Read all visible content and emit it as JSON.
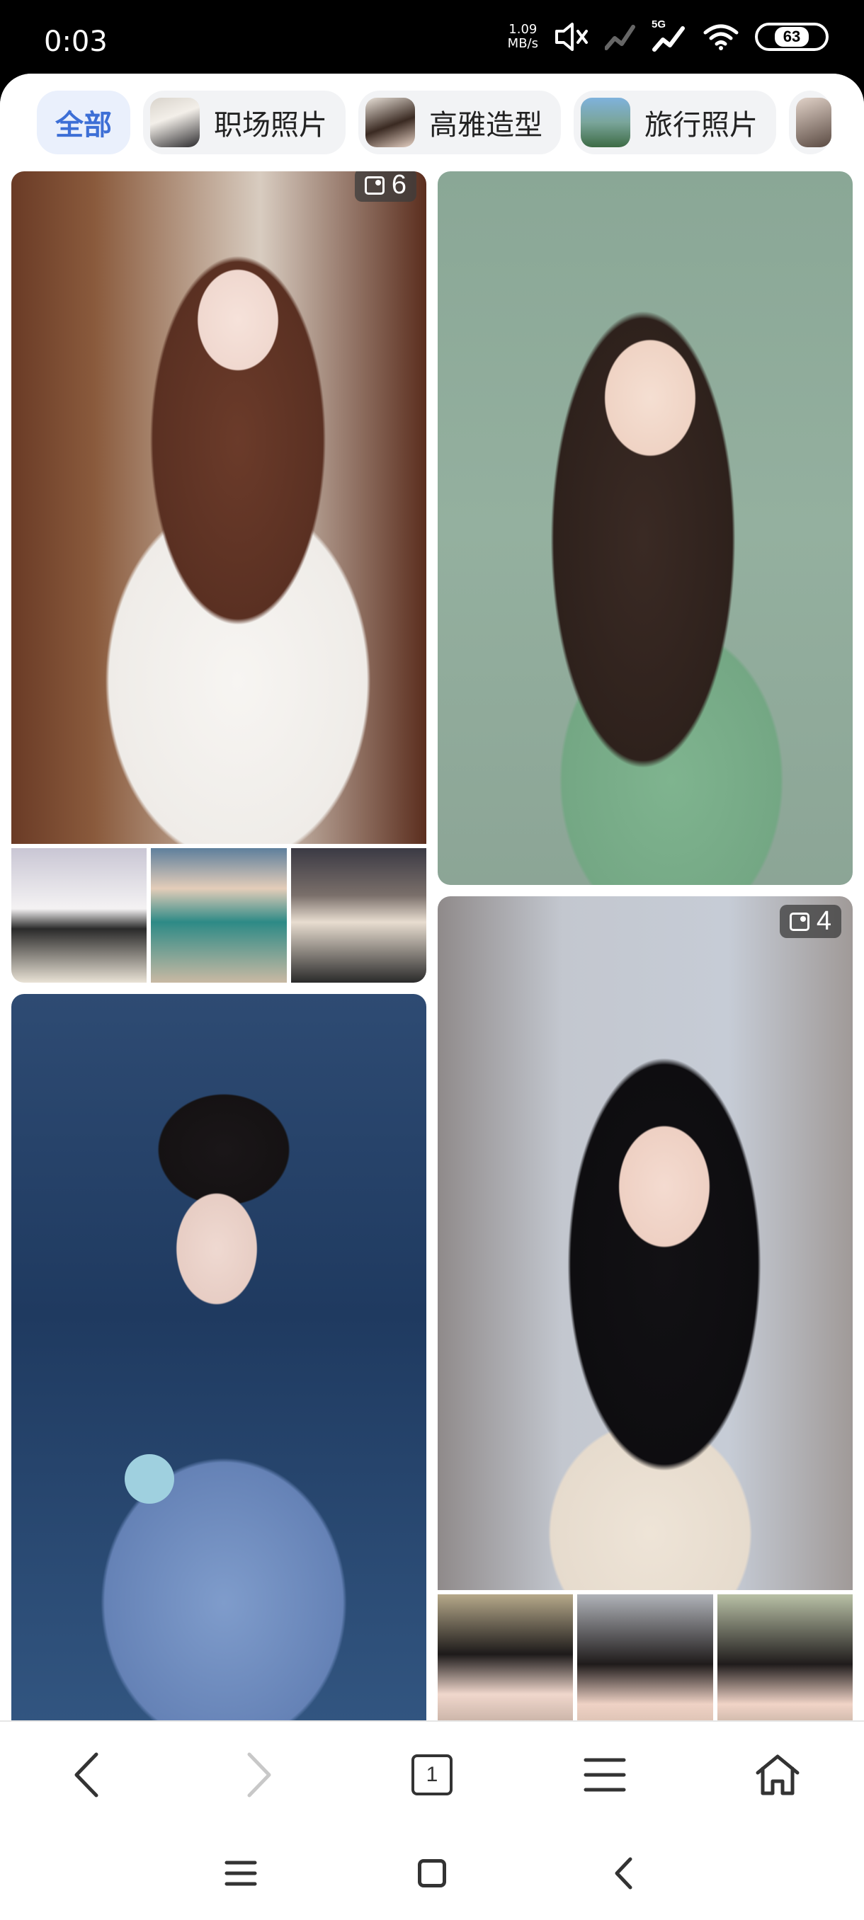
{
  "status": {
    "time": "0:03",
    "net_speed_value": "1.09",
    "net_speed_unit": "MB/s",
    "network": "5G",
    "battery": "63"
  },
  "tabs": [
    {
      "label": "全部",
      "active": true
    },
    {
      "label": "职场照片",
      "active": false
    },
    {
      "label": "高雅造型",
      "active": false
    },
    {
      "label": "旅行照片",
      "active": false
    }
  ],
  "cards": [
    {
      "photo_count": "6"
    },
    {
      "photo_count": "4"
    }
  ],
  "browser_bar": {
    "tab_count": "1"
  },
  "colors": {
    "accent": "#3d6fd6",
    "tab_bg": "#f2f3f5",
    "active_tab_bg": "#eaf0fc"
  }
}
